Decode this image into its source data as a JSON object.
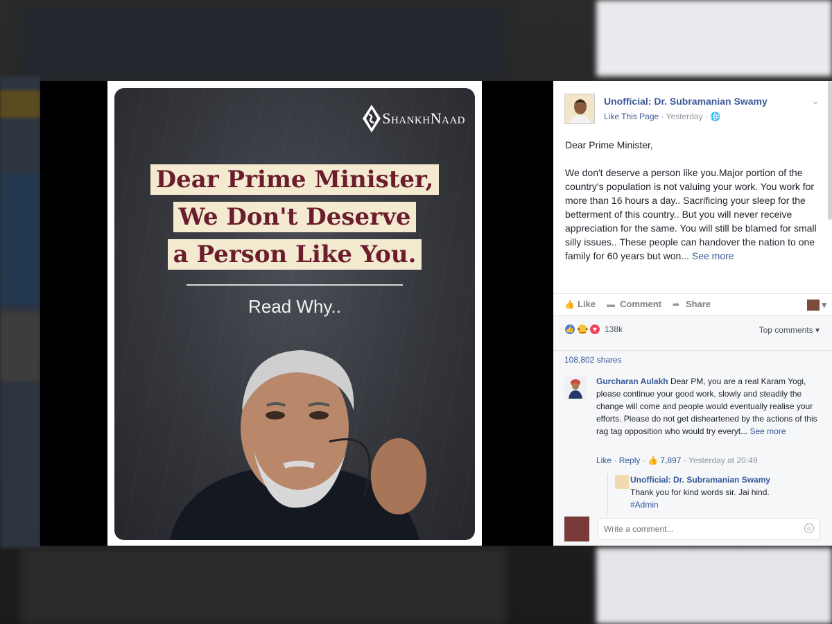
{
  "poster": {
    "brand": "ShankhNaad",
    "headline": [
      "Dear Prime Minister,",
      "We Don't Deserve",
      "a Person Like You."
    ],
    "subtext": "Read Why.."
  },
  "post": {
    "page_name": "Unofficial: Dr. Subramanian Swamy",
    "like_page": "Like This Page",
    "timestamp": "Yesterday",
    "greeting": "Dear Prime Minister,",
    "body": "We don't deserve a person like you.Major portion of the country's population is not valuing your work. You work for more than 16 hours a day.. Sacrificing your sleep for the betterment of this country.. But you will never receive appreciation for the same. You will still be blamed for small silly issues.. These people can handover the nation to one family for 60 years but won...",
    "see_more": "See more"
  },
  "actions": {
    "like": "Like",
    "comment": "Comment",
    "share": "Share"
  },
  "feedback": {
    "reactions_count": "138k",
    "top_comments": "Top comments",
    "shares": "108,802 shares"
  },
  "comment": {
    "author": "Gurcharan Aulakh",
    "text": "Dear PM, you are a real Karam Yogi, please continue your good work, slowly and steadily the change will come and people would eventually realise your efforts. Please do not get disheartened by the actions of this rag tag opposition who would try everyt...",
    "see_more": "See more",
    "like": "Like",
    "reply": "Reply",
    "likes": "7,897",
    "time": "Yesterday at 20:49"
  },
  "reply": {
    "author": "Unofficial: Dr. Subramanian Swamy",
    "text": "Thank you for kind words sir. Jai hind.",
    "tag": "#Admin"
  },
  "composer": {
    "placeholder": "Write a comment..."
  },
  "colors": {
    "link": "#365899",
    "headline_text": "#6b1d2e",
    "headline_bg": "#f3ead0"
  }
}
